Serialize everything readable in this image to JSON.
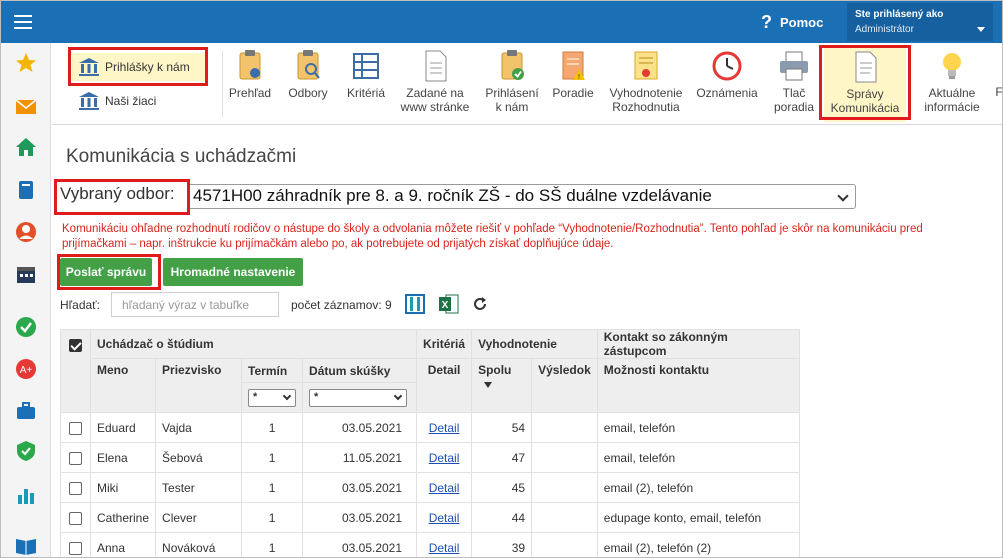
{
  "topbar": {
    "help_label": "Pomoc",
    "help_glyph": "?",
    "user_line1": "Ste prihlásený ako",
    "user_line2": "Administrátor"
  },
  "sidebar": {
    "icons": [
      "star-icon",
      "mail-icon",
      "home-icon",
      "book-icon",
      "user-icon",
      "calendar-icon",
      "check-circle-icon",
      "pie-icon",
      "briefcase-icon",
      "shield-icon",
      "bar-chart-icon",
      "open-book-icon"
    ]
  },
  "ribbon": {
    "side_items": [
      {
        "label": "Prihlášky k nám",
        "icon": "school-building-icon"
      },
      {
        "label": "Naši žiaci",
        "icon": "school-building-icon"
      }
    ],
    "tools": [
      {
        "line1": "Prehľad",
        "line2": "",
        "icon": "clipboard-eye-icon"
      },
      {
        "line1": "Odbory",
        "line2": "",
        "icon": "clipboard-search-icon"
      },
      {
        "line1": "Kritériá",
        "line2": "",
        "icon": "grid-icon"
      },
      {
        "line1": "Zadané na",
        "line2": "www stránke",
        "icon": "document-icon"
      },
      {
        "line1": "Prihlásení",
        "line2": "k nám",
        "icon": "clipboard-check-icon"
      },
      {
        "line1": "Poradie",
        "line2": "",
        "icon": "document-warning-icon"
      },
      {
        "line1": "Vyhodnotenie",
        "line2": "Rozhodnutia",
        "icon": "certificate-icon"
      },
      {
        "line1": "Oznámenia",
        "line2": "",
        "icon": "clock-icon"
      },
      {
        "line1": "Tlač",
        "line2": "poradia",
        "icon": "printer-icon"
      },
      {
        "line1": "Správy",
        "line2": "Komunikácia",
        "icon": "note-icon"
      },
      {
        "line1": "Aktuálne",
        "line2": "informácie",
        "icon": "lightbulb-icon"
      },
      {
        "line1": "F",
        "line2": "",
        "icon": ""
      }
    ]
  },
  "page": {
    "title": "Komunikácia s uchádzačmi",
    "odbor_label": "Vybraný odbor:",
    "odbor_value": "4571H00 záhradník pre 8. a 9. ročník ZŠ - do SŠ duálne vzdelávanie",
    "note": "Komunikáciu ohľadne rozhodnutí rodičov o nástupe do školy a odvolania môžete riešiť v pohľade “Vyhodnotenie/Rozhodnutia”. Tento pohľad je skôr na komunikáciu pred prijímačkami – napr. inštrukcie ku prijímačkám alebo po, ak potrebujete od prijatých získať doplňujúce údaje.",
    "send_button": "Poslať správu",
    "bulk_button": "Hromadné nastavenie",
    "search_label": "Hľadať:",
    "search_placeholder": "hľadaný výraz v tabuľke",
    "count_label": "počet záznamov: 9"
  },
  "table": {
    "group_headers": {
      "applicant": "Uchádzač o štúdium",
      "criteria": "Kritériá",
      "evaluation": "Vyhodnotenie",
      "contact": "Kontakt so zákonným zástupcom"
    },
    "columns": {
      "meno": "Meno",
      "priezvisko": "Priezvisko",
      "termin": "Termín",
      "datum": "Dátum skúšky",
      "detail": "Detail",
      "spolu": "Spolu",
      "vysledok": "Výsledok",
      "moznosti": "Možnosti kontaktu"
    },
    "filters": {
      "termin": "*",
      "datum": "*"
    },
    "rows": [
      {
        "meno": "Eduard",
        "priezvisko": "Vajda",
        "termin": "1",
        "datum": "03.05.2021",
        "detail": "Detail",
        "spolu": "54",
        "vysledok": "",
        "kontakt": "email, telefón"
      },
      {
        "meno": "Elena",
        "priezvisko": "Šebová",
        "termin": "1",
        "datum": "11.05.2021",
        "detail": "Detail",
        "spolu": "47",
        "vysledok": "",
        "kontakt": "email, telefón"
      },
      {
        "meno": "Miki",
        "priezvisko": "Tester",
        "termin": "1",
        "datum": "03.05.2021",
        "detail": "Detail",
        "spolu": "45",
        "vysledok": "",
        "kontakt": "email (2), telefón"
      },
      {
        "meno": "Catherine",
        "priezvisko": "Clever",
        "termin": "1",
        "datum": "03.05.2021",
        "detail": "Detail",
        "spolu": "44",
        "vysledok": "",
        "kontakt": "edupage konto, email, telefón"
      },
      {
        "meno": "Anna",
        "priezvisko": "Nováková",
        "termin": "1",
        "datum": "03.05.2021",
        "detail": "Detail",
        "spolu": "39",
        "vysledok": "",
        "kontakt": "email (2), telefón (2)"
      }
    ]
  },
  "colors": {
    "topbar": "#1b6fb5",
    "highlight_box": "#e01b1b",
    "green_button": "#43a047",
    "note_text": "#d9251d",
    "link": "#1a4fb4"
  }
}
